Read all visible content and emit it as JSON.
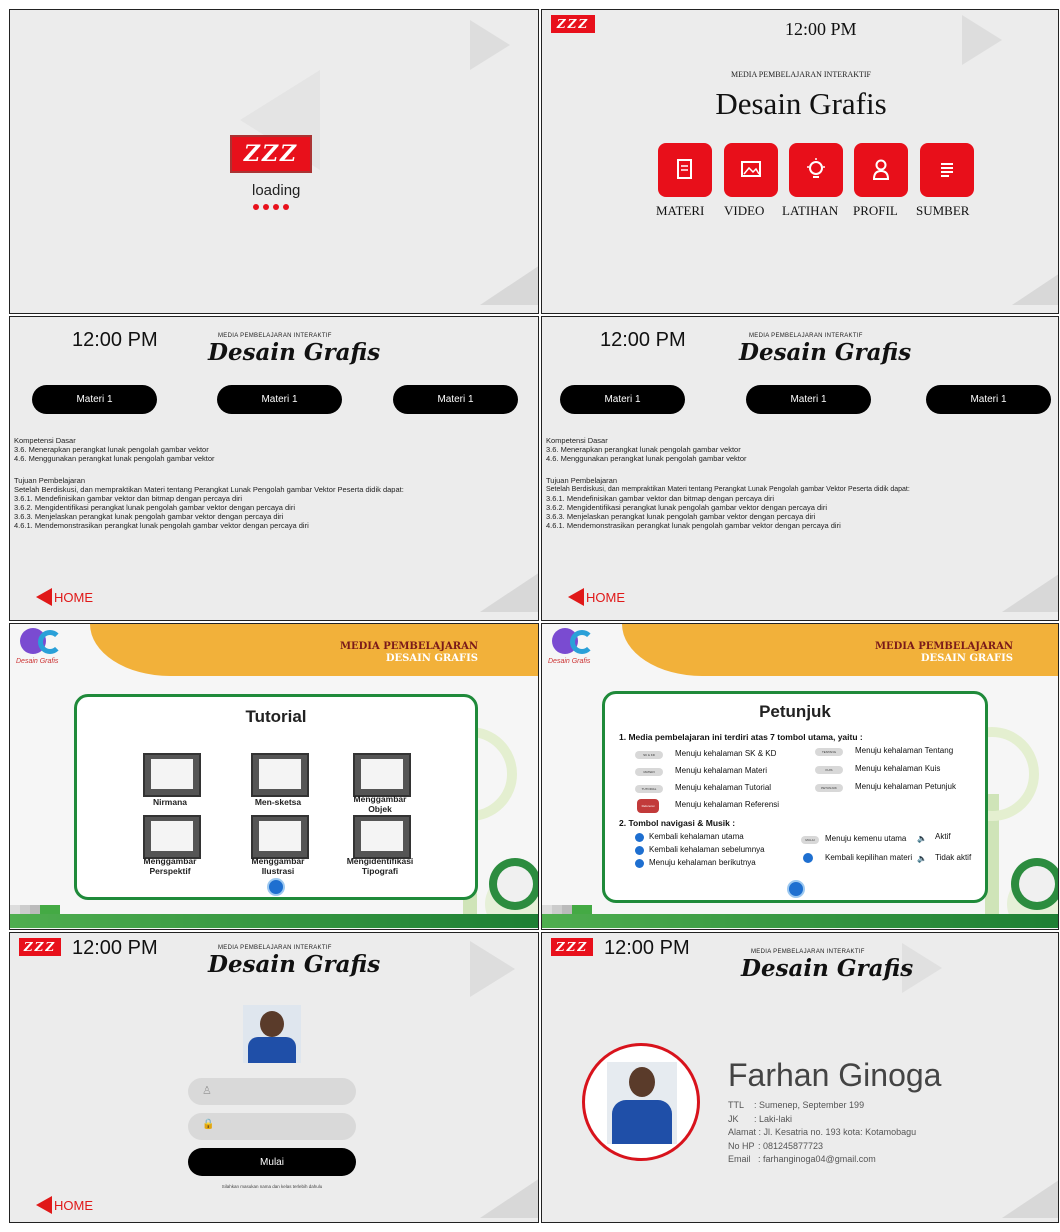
{
  "logo_text": "ZZZ",
  "loading": {
    "text": "loading"
  },
  "clock": "12:00 PM",
  "home_label": "HOME",
  "main_menu": {
    "subtitle": "MEDIA PEMBELAJARAN INTERAKTIF",
    "title": "Desain Grafis",
    "buttons": [
      {
        "label": "MATERI",
        "icon": "document-icon"
      },
      {
        "label": "VIDEO",
        "icon": "image-icon"
      },
      {
        "label": "LATIHAN",
        "icon": "lightbulb-icon"
      },
      {
        "label": "PROFIL",
        "icon": "person-icon"
      },
      {
        "label": "SUMBER",
        "icon": "list-icon"
      }
    ]
  },
  "header_small": {
    "subtitle": "MEDIA PEMBELAJARAN INTERAKTIF",
    "title": "Desain Grafis"
  },
  "materi": {
    "tabs": [
      "Materi 1",
      "Materi 1",
      "Materi 1"
    ],
    "kd_heading": "Kompetensi Dasar",
    "kd_lines": [
      "3.6. Menerapkan perangkat lunak pengolah gambar vektor",
      "4.6. Menggunakan perangkat lunak pengolah gambar vektor"
    ],
    "tp_heading": "Tujuan Pembelajaran",
    "tp_intro": "Setelah Berdiskusi, dan mempraktikan Materi tentang Perangkat Lunak Pengolah gambar Vektor Peserta didik dapat:",
    "tp_lines": [
      "3.6.1. Mendefinisikan gambar vektor dan bitmap dengan percaya diri",
      "3.6.2. Mengidentifikasi perangkat lunak pengolah gambar vektor dengan percaya diri",
      "3.6.3. Menjelaskan perangkat lunak pengolah gambar vektor dengan percaya diri",
      "4.6.1. Mendemonstrasikan perangkat lunak pengolah gambar vektor dengan percaya diri"
    ]
  },
  "dg_header": {
    "logo_caption": "Desain Grafis",
    "line1": "MEDIA PEMBELAJARAN",
    "line2": "DESAIN GRAFIS"
  },
  "tutorial": {
    "title": "Tutorial",
    "items": [
      "Nirmana",
      "Men-sketsa",
      "Menggambar\nObjek",
      "Menggambar\nPerspektif",
      "Menggambar\nIlustrasi",
      "Mengidentifikasi\nTipografi"
    ]
  },
  "petunjuk": {
    "title": "Petunjuk",
    "heading1": "1. Media pembelajaran ini terdiri atas 7 tombol utama, yaitu :",
    "left_rows": [
      {
        "pill": "SK & KD",
        "text": "Menuju kehalaman SK & KD"
      },
      {
        "pill": "MATERI",
        "text": "Menuju kehalaman Materi"
      },
      {
        "pill": "TUTORIAL",
        "text": "Menuju kehalaman Tutorial"
      },
      {
        "pill": "Referensi",
        "text": "Menuju kehalaman Referensi"
      }
    ],
    "right_rows": [
      {
        "pill": "TENTANG",
        "text": "Menuju kehalaman Tentang"
      },
      {
        "pill": "KUIS",
        "text": "Menuju kehalaman Kuis"
      },
      {
        "pill": "PETUNJUK",
        "text": "Menuju kehalaman Petunjuk"
      }
    ],
    "heading2": "2. Tombol navigasi & Musik :",
    "nav_rows": [
      "Kembali kehalaman utama",
      "Kembali kehalaman sebelumnya",
      "Menuju kehalaman berikutnya"
    ],
    "nav_right": [
      {
        "pill": "MULAI",
        "text": "Menuju kemenu utama"
      },
      {
        "pill": "",
        "text": "Kembali kepilihan materi"
      }
    ],
    "sound": [
      "Aktif",
      "Tidak aktif"
    ]
  },
  "login": {
    "button": "Mulai",
    "hint": "Silahkan masukan nama dan kelas terlebih dahulu"
  },
  "profile": {
    "name": "Farhan Ginoga",
    "labels": [
      "TTL",
      "JK",
      "Alamat",
      "No HP",
      "Email"
    ],
    "values": [
      ": Sumenep, September 199",
      ": Laki-laki",
      ": Jl. Kesatria no. 193 kota: Kotamobagu",
      ": 081245877723",
      ": farhanginoga04@gmail.com"
    ]
  },
  "colors": {
    "accent": "#e8101b",
    "banner": "#f2b13a",
    "green": "#1f8a3a"
  }
}
